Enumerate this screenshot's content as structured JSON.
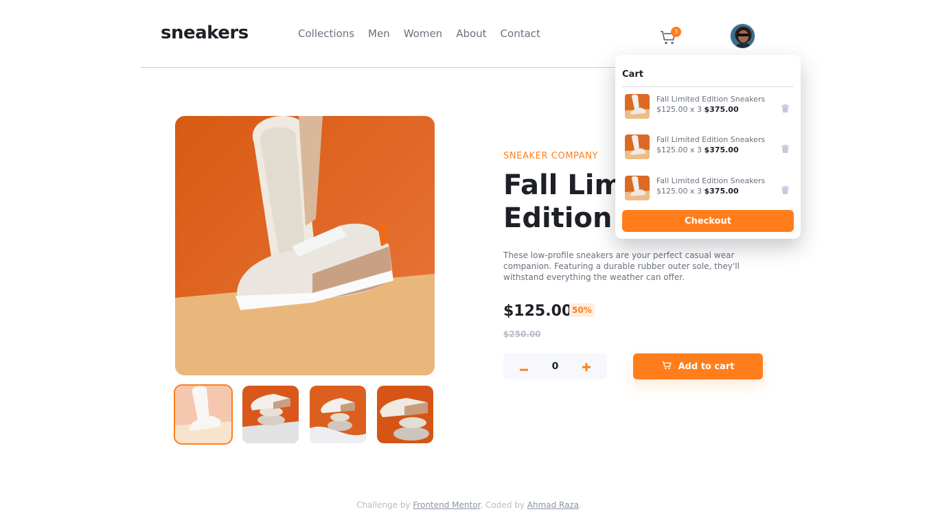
{
  "header": {
    "logo": "sneakers",
    "nav": [
      "Collections",
      "Men",
      "Women",
      "About",
      "Contact"
    ],
    "cart_count": "3"
  },
  "product": {
    "company": "SNEAKER COMPANY",
    "title": "Fall Limited Edition Sneakers",
    "description": "These low-profile sneakers are your perfect casual wear companion. Featuring a durable rubber outer sole, they'll withstand everything the weather can offer.",
    "price": "$125.00",
    "discount": "50%",
    "old_price": "$250.00",
    "quantity": "0",
    "add_to_cart": "Add to cart"
  },
  "cart": {
    "title": "Cart",
    "items": [
      {
        "name": "Fall Limited Edition Sneakers",
        "unit": "$125.00 x 3",
        "total": "$375.00"
      },
      {
        "name": "Fall Limited Edition Sneakers",
        "unit": "$125.00 x 3",
        "total": "$375.00"
      },
      {
        "name": "Fall Limited Edition Sneakers",
        "unit": "$125.00 x 3",
        "total": "$375.00"
      }
    ],
    "checkout": "Checkout"
  },
  "footer": {
    "prefix": "Challenge by ",
    "link1": "Frontend Mentor",
    "middle": ". Coded by ",
    "link2": "Ahmad Raza",
    "suffix": "."
  },
  "colors": {
    "accent": "#ff7e1b",
    "text_dark": "#1d2026",
    "text_muted": "#69707d"
  }
}
